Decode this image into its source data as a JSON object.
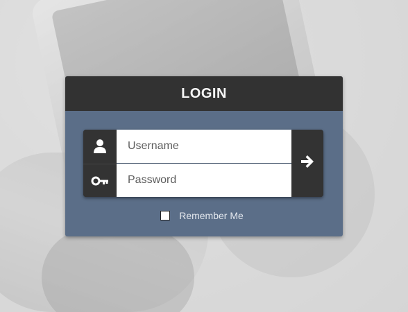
{
  "login": {
    "title": "LOGIN",
    "username": {
      "placeholder": "Username",
      "value": "",
      "icon": "user-icon"
    },
    "password": {
      "placeholder": "Password",
      "value": "",
      "icon": "key-icon"
    },
    "submit": {
      "icon": "arrow-right-icon"
    },
    "remember": {
      "label": "Remember Me",
      "checked": false
    }
  },
  "colors": {
    "header_bg": "#323232",
    "card_bg": "#5b6e88",
    "icon_cell_bg": "#333333",
    "input_bg": "#ffffff",
    "title_text": "#f5f5f5"
  }
}
